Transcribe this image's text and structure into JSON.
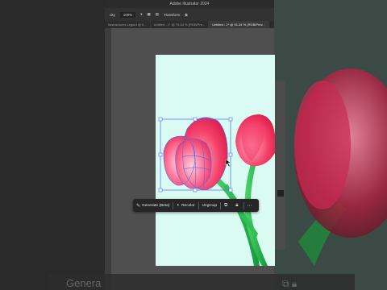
{
  "window": {
    "title": "Adobe Illustrator 2024"
  },
  "control_bar": {
    "left_label": "city",
    "zoom": "100%",
    "transform_label": "Transform"
  },
  "tabs": [
    {
      "label": "Ilustraciones Legaut @ 6..."
    },
    {
      "label": "Untitled - 1* @ 75.34 % (RGB/Pre..."
    },
    {
      "label": "Untitled - 2* @ 91.34 % (RGB/Prev..."
    }
  ],
  "context_toolbar": {
    "generate_label": "Generate (Beta)",
    "recolor_label": "Recolor",
    "ungroup_label": "Ungroup"
  },
  "background": {
    "ghost_text": "Genera"
  },
  "colors": {
    "artboard": "#d9fbf2",
    "petal_main": "#f0345f",
    "petal_light": "#ff9bb6",
    "stem": "#24b04a",
    "selection": "#4a6cff"
  }
}
